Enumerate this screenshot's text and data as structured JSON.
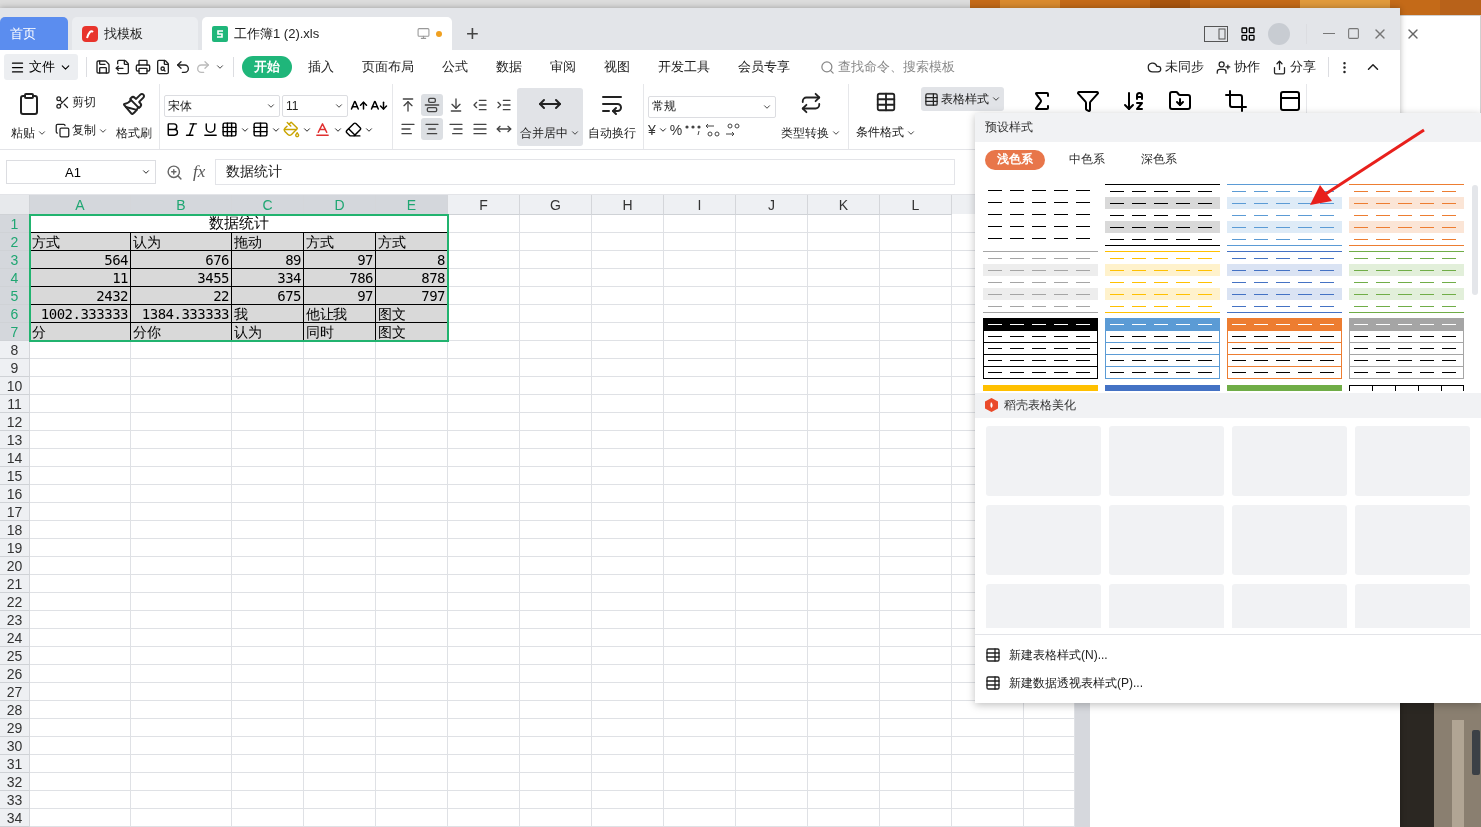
{
  "tabs": [
    {
      "label": "首页",
      "kind": "home",
      "selected": false
    },
    {
      "label": "找模板",
      "kind": "template",
      "selected": false
    },
    {
      "label": "工作簿1 (2).xls",
      "kind": "sheet",
      "selected": true,
      "unsaved": true
    }
  ],
  "new_tab": "+",
  "menu": {
    "file": "文件",
    "tabs": [
      {
        "label": "开始",
        "selected": true
      },
      {
        "label": "插入",
        "selected": false
      },
      {
        "label": "页面布局",
        "selected": false
      },
      {
        "label": "公式",
        "selected": false
      },
      {
        "label": "数据",
        "selected": false
      },
      {
        "label": "审阅",
        "selected": false
      },
      {
        "label": "视图",
        "selected": false
      },
      {
        "label": "开发工具",
        "selected": false
      },
      {
        "label": "会员专享",
        "selected": false
      }
    ],
    "search": {
      "placeholder": "查找命令、搜索模板"
    },
    "actions": [
      {
        "label": "未同步",
        "kind": "sync"
      },
      {
        "label": "协作",
        "kind": "collab"
      },
      {
        "label": "分享",
        "kind": "share"
      }
    ]
  },
  "ribbon": {
    "paste": "粘贴",
    "cut": "剪切",
    "copy": "复制",
    "format_painter": "格式刷",
    "font": "宋体",
    "font_size": "11",
    "align_buttons": [
      {
        "kind": "top",
        "selected": false
      },
      {
        "kind": "middle",
        "selected": true
      },
      {
        "kind": "bottom",
        "selected": false
      },
      {
        "kind": "outdent",
        "selected": false
      },
      {
        "kind": "indent",
        "selected": false
      },
      {
        "kind": "left",
        "selected": false
      },
      {
        "kind": "center",
        "selected": true
      },
      {
        "kind": "right",
        "selected": false
      },
      {
        "kind": "justify",
        "selected": false
      },
      {
        "kind": "distribute",
        "selected": false
      }
    ],
    "merge": {
      "label": "合并居中",
      "selected": true
    },
    "wrap": "自动换行",
    "number_format": "常规",
    "currency": "¥",
    "percent": "%",
    "convert": "类型转换",
    "conditional_format": "条件格式",
    "table_style": {
      "label": "表格样式",
      "selected": true
    }
  },
  "formula_bar": {
    "cell": "A1",
    "fx": "fx",
    "value": "数据统计"
  },
  "sheet": {
    "columns": [
      {
        "label": "A",
        "selected": true
      },
      {
        "label": "B",
        "selected": true
      },
      {
        "label": "C",
        "selected": true
      },
      {
        "label": "D",
        "selected": true
      },
      {
        "label": "E",
        "selected": true
      },
      {
        "label": "F",
        "selected": false
      },
      {
        "label": "G",
        "selected": false
      },
      {
        "label": "H",
        "selected": false
      },
      {
        "label": "I",
        "selected": false
      },
      {
        "label": "J",
        "selected": false
      },
      {
        "label": "K",
        "selected": false
      },
      {
        "label": "L",
        "selected": false
      }
    ],
    "rows": [
      {
        "label": "1",
        "selected": true
      },
      {
        "label": "2",
        "selected": true
      },
      {
        "label": "3",
        "selected": true
      },
      {
        "label": "4",
        "selected": true
      },
      {
        "label": "5",
        "selected": true
      },
      {
        "label": "6",
        "selected": true
      },
      {
        "label": "7",
        "selected": true
      },
      {
        "label": "8",
        "selected": false
      },
      {
        "label": "9",
        "selected": false
      },
      {
        "label": "10",
        "selected": false
      },
      {
        "label": "11",
        "selected": false
      },
      {
        "label": "12",
        "selected": false
      },
      {
        "label": "13",
        "selected": false
      },
      {
        "label": "14",
        "selected": false
      },
      {
        "label": "15",
        "selected": false
      },
      {
        "label": "16",
        "selected": false
      },
      {
        "label": "17",
        "selected": false
      },
      {
        "label": "18",
        "selected": false
      },
      {
        "label": "19",
        "selected": false
      },
      {
        "label": "20",
        "selected": false
      },
      {
        "label": "21",
        "selected": false
      },
      {
        "label": "22",
        "selected": false
      },
      {
        "label": "23",
        "selected": false
      },
      {
        "label": "24",
        "selected": false
      },
      {
        "label": "25",
        "selected": false
      },
      {
        "label": "26",
        "selected": false
      },
      {
        "label": "27",
        "selected": false
      },
      {
        "label": "28",
        "selected": false
      },
      {
        "label": "29",
        "selected": false
      },
      {
        "label": "30",
        "selected": false
      },
      {
        "label": "31",
        "selected": false
      },
      {
        "label": "32",
        "selected": false
      },
      {
        "label": "33",
        "selected": false
      },
      {
        "label": "34",
        "selected": false
      }
    ],
    "title": "数据统计",
    "data": [
      [
        {
          "v": "方式",
          "kind": "text"
        },
        {
          "v": "认为",
          "kind": "text"
        },
        {
          "v": "拖动",
          "kind": "text"
        },
        {
          "v": "方式",
          "kind": "text"
        },
        {
          "v": "方式",
          "kind": "text"
        }
      ],
      [
        {
          "v": "564",
          "kind": "number"
        },
        {
          "v": "676",
          "kind": "number"
        },
        {
          "v": "89",
          "kind": "number"
        },
        {
          "v": "97",
          "kind": "number"
        },
        {
          "v": "8",
          "kind": "number"
        }
      ],
      [
        {
          "v": "11",
          "kind": "number"
        },
        {
          "v": "3455",
          "kind": "number"
        },
        {
          "v": "334",
          "kind": "number"
        },
        {
          "v": "786",
          "kind": "number"
        },
        {
          "v": "878",
          "kind": "number"
        }
      ],
      [
        {
          "v": "2432",
          "kind": "number"
        },
        {
          "v": "22",
          "kind": "number"
        },
        {
          "v": "675",
          "kind": "number"
        },
        {
          "v": "97",
          "kind": "number"
        },
        {
          "v": "797",
          "kind": "number"
        }
      ],
      [
        {
          "v": "1002.333333",
          "kind": "number"
        },
        {
          "v": "1384.333333",
          "kind": "number"
        },
        {
          "v": "我",
          "kind": "text"
        },
        {
          "v": "他让我",
          "kind": "text"
        },
        {
          "v": "图文",
          "kind": "text"
        }
      ],
      [
        {
          "v": "分",
          "kind": "text"
        },
        {
          "v": "分你",
          "kind": "text"
        },
        {
          "v": "认为",
          "kind": "text"
        },
        {
          "v": "同时",
          "kind": "text"
        },
        {
          "v": "图文",
          "kind": "text"
        }
      ]
    ]
  },
  "style_panel": {
    "title": "预设样式",
    "tabs": [
      {
        "label": "浅色系",
        "selected": true
      },
      {
        "label": "中色系",
        "selected": false
      },
      {
        "label": "深色系",
        "selected": false
      }
    ],
    "presets": [
      {
        "kind": "plain",
        "color": "#000000"
      },
      {
        "kind": "banded",
        "color": "#000000"
      },
      {
        "kind": "banded",
        "color": "#5b9bd5"
      },
      {
        "kind": "banded",
        "color": "#ed7d31"
      },
      {
        "kind": "banded",
        "color": "#a5a5a5"
      },
      {
        "kind": "banded",
        "color": "#ffc000"
      },
      {
        "kind": "banded",
        "color": "#4472c4"
      },
      {
        "kind": "banded",
        "color": "#70ad47"
      },
      {
        "kind": "header",
        "color": "#000000"
      },
      {
        "kind": "header",
        "color": "#5b9bd5"
      },
      {
        "kind": "header",
        "color": "#ed7d31"
      },
      {
        "kind": "header",
        "color": "#a5a5a5"
      },
      {
        "kind": "header",
        "color": "#ffc000"
      },
      {
        "kind": "header",
        "color": "#4472c4"
      },
      {
        "kind": "header",
        "color": "#70ad47"
      },
      {
        "kind": "grid",
        "color": "#000000"
      }
    ],
    "section": "稻壳表格美化",
    "cards": [
      {
        "kind": "placeholder"
      },
      {
        "kind": "placeholder"
      },
      {
        "kind": "placeholder"
      },
      {
        "kind": "placeholder"
      },
      {
        "kind": "placeholder"
      },
      {
        "kind": "placeholder"
      },
      {
        "kind": "placeholder"
      },
      {
        "kind": "placeholder"
      },
      {
        "kind": "placeholder"
      },
      {
        "kind": "placeholder"
      },
      {
        "kind": "placeholder"
      },
      {
        "kind": "placeholder"
      }
    ],
    "commands": [
      "新建表格样式(N)...",
      "新建数据透视表样式(P)..."
    ]
  }
}
